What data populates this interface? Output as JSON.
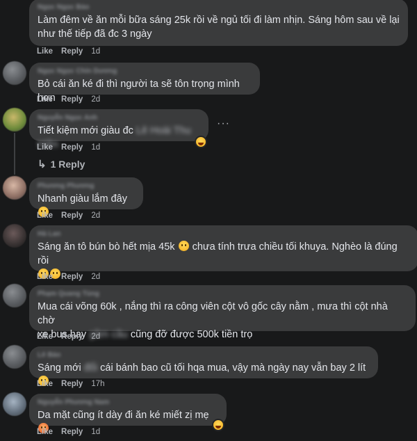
{
  "actions": {
    "like": "Like",
    "reply": "Reply"
  },
  "comments": [
    {
      "author": "Ngọc Ngọc Bảo",
      "lines": [
        "Làm đêm về ăn mỗi bữa sáng 25k rồi về ngủ tối đi làm nhịn. Sáng hôm sau về lại",
        "như thế tiếp đã đc 3 ngày"
      ],
      "time": "1d"
    },
    {
      "author": "Ngọc Ngọc Chín Dương",
      "lines": [
        "Bỏ cái ăn ké đi thì người ta sẽ tôn trọng mình hơn"
      ],
      "time": "2d"
    },
    {
      "author": "Nguyễn Ngọc Anh",
      "text": "Tiết kiệm mới giàu đc",
      "hidden": "Lê Hoài Thu Hiền",
      "time": "1d",
      "reply_count": "1 Reply"
    },
    {
      "author": "Phương Phương",
      "text": "Nhanh giàu lắm đây",
      "time": "2d"
    },
    {
      "author": "Hà Lan",
      "text_a": "Sáng ăn tô bún bò hết mịa 45k",
      "text_b": "chưa tính trưa chiều tối khuya. Nghèo là đúng rồi",
      "time": "2d"
    },
    {
      "author": "Phạm Quang Tùng",
      "line1": "Mua cái võng 60k , nắng thì ra công viên cột vô gốc cây nằm , mưa thì cột nhà chờ",
      "line2_a": "xe bus hay",
      "line2_hidden": "gầm cầu",
      "line2_b": "cũng đỡ được 500k tiền trọ",
      "time": "2d"
    },
    {
      "author": "Lê Bảo",
      "text_a": "Sáng mới",
      "hidden": "đổi",
      "text_b": "cái bánh bao cũ tối hqa mua, vậy mà ngày nay vẫn bay 2 lít",
      "time": "17h"
    },
    {
      "author": "Nguyễn Phương Nam",
      "text": "Da mặt cũng ít dày đi ăn ké miết zị mẹ",
      "time": "1d"
    }
  ]
}
